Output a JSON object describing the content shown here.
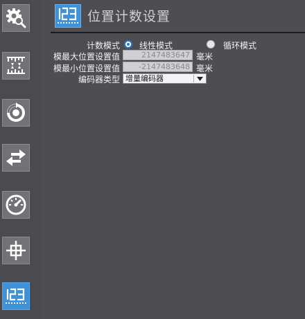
{
  "header": {
    "icon": "counter-123-icon",
    "title": "位置计数设置"
  },
  "sidebar": {
    "items": [
      {
        "icon": "gear-search-icon",
        "active": false
      },
      {
        "icon": "ruler-arrows-icon",
        "active": false
      },
      {
        "icon": "rotation-icon",
        "active": false
      },
      {
        "icon": "swap-arrows-icon",
        "active": false
      },
      {
        "icon": "gauge-icon",
        "active": false
      },
      {
        "icon": "crosshair-icon",
        "active": false
      },
      {
        "icon": "counter-123-icon",
        "active": true
      }
    ]
  },
  "form": {
    "count_mode": {
      "label": "计数模式",
      "options": [
        {
          "label": "线性模式",
          "selected": true
        },
        {
          "label": "循环模式",
          "selected": false
        }
      ]
    },
    "modulo_max": {
      "label": "模最大位置设置值",
      "value": "2147483647",
      "unit": "毫米"
    },
    "modulo_min": {
      "label": "模最小位置设置值",
      "value": "-2147483648",
      "unit": "毫米"
    },
    "encoder_type": {
      "label": "编码器类型",
      "value": "增量编码器"
    }
  },
  "colors": {
    "background": "#4d4d52",
    "accent": "#3f92d8",
    "sidebar_button": "#727276"
  }
}
